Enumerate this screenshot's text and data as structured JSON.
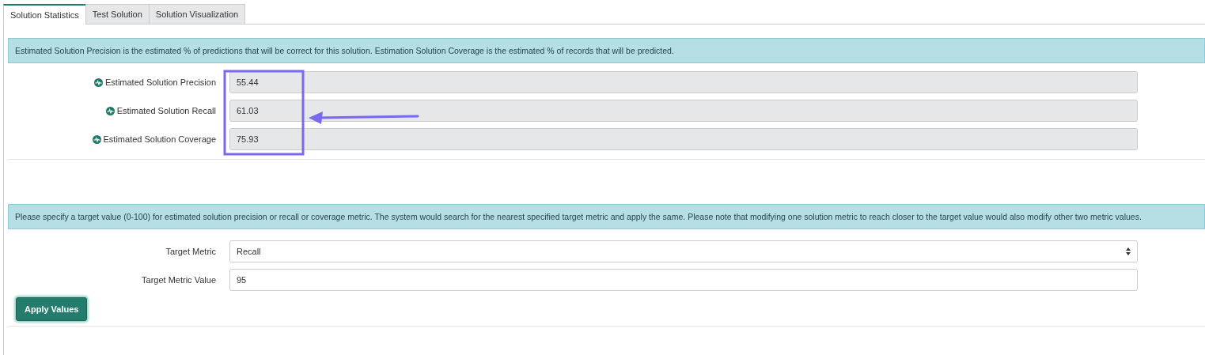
{
  "tabs": [
    {
      "label": "Solution Statistics",
      "selected": true
    },
    {
      "label": "Test Solution",
      "selected": false
    },
    {
      "label": "Solution Visualization",
      "selected": false
    }
  ],
  "statistics": {
    "info": "Estimated Solution Precision is the estimated % of predictions that will be correct for this solution. Estimation Solution Coverage is the estimated % of records that will be predicted.",
    "metrics": [
      {
        "label": "Estimated Solution Precision",
        "value": "55.44"
      },
      {
        "label": "Estimated Solution Recall",
        "value": "61.03"
      },
      {
        "label": "Estimated Solution Coverage",
        "value": "75.93"
      }
    ]
  },
  "target": {
    "info": "Please specify a target value (0-100) for estimated solution precision or recall or coverage metric. The system would search for the nearest specified target metric and apply the same. Please note that modifying one solution metric to reach closer to the target value would also modify other two metric values.",
    "metric_label": "Target Metric",
    "metric_value": "Recall",
    "value_label": "Target Metric Value",
    "value": "95",
    "button": "Apply Values"
  }
}
